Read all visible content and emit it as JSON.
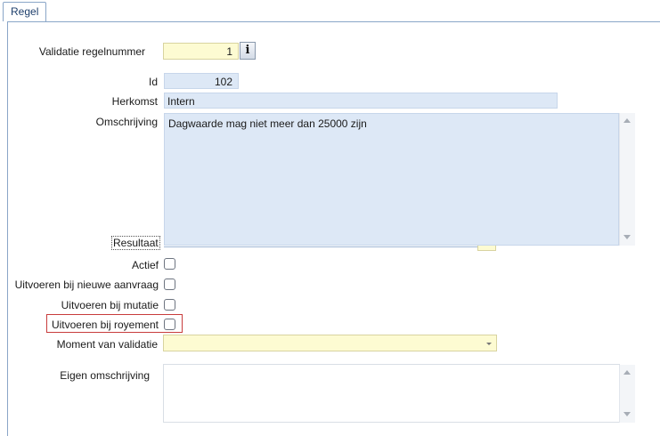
{
  "tab": {
    "label": "Regel"
  },
  "form": {
    "validatie_regelnummer": {
      "label": "Validatie regelnummer",
      "value": "1"
    },
    "info_icon": {
      "glyph": "i"
    },
    "id": {
      "label": "Id",
      "value": "102"
    },
    "herkomst": {
      "label": "Herkomst",
      "value": "Intern"
    },
    "omschrijving": {
      "label": "Omschrijving",
      "value": "Dagwaarde mag niet meer dan 25000 zijn"
    },
    "resultaat": {
      "label": "Resultaat"
    },
    "actief": {
      "label": "Actief"
    },
    "nieuwe_aanvraag": {
      "label": "Uitvoeren bij nieuwe aanvraag"
    },
    "mutatie": {
      "label": "Uitvoeren bij mutatie"
    },
    "royement": {
      "label": "Uitvoeren bij royement"
    },
    "moment": {
      "label": "Moment van validatie",
      "value": ""
    },
    "eigen_omschrijving": {
      "label": "Eigen omschrijving",
      "value": ""
    }
  },
  "colors": {
    "yellow_field": "#fdfbd2",
    "blue_field": "#dde8f6",
    "focus": "#c83c3c"
  }
}
